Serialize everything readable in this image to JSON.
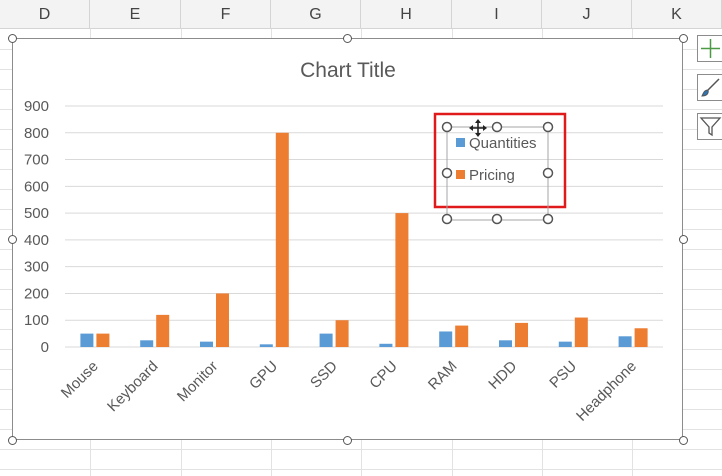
{
  "spreadsheet": {
    "columns": [
      "D",
      "E",
      "F",
      "G",
      "H",
      "I",
      "J",
      "K"
    ]
  },
  "chart_tools": {
    "add_element_icon": "plus-icon",
    "style_icon": "brush-icon",
    "filter_icon": "funnel-icon"
  },
  "chart_data": {
    "type": "bar",
    "title": "Chart Title",
    "categories": [
      "Mouse",
      "Keyboard",
      "Monitor",
      "GPU",
      "SSD",
      "CPU",
      "RAM",
      "HDD",
      "PSU",
      "Headphone"
    ],
    "series": [
      {
        "name": "Quantities",
        "color": "#5b9bd5",
        "values": [
          50,
          25,
          20,
          10,
          50,
          12,
          58,
          25,
          20,
          40
        ]
      },
      {
        "name": "Pricing",
        "color": "#ed7d31",
        "values": [
          50,
          120,
          200,
          800,
          100,
          500,
          80,
          90,
          110,
          70
        ]
      }
    ],
    "ylim": [
      0,
      900
    ],
    "yticks": [
      0,
      100,
      200,
      300,
      400,
      500,
      600,
      700,
      800,
      900
    ],
    "grid": true,
    "legend_position": "top-right",
    "legend_selected": true,
    "selection_highlight_color": "#e01a1a"
  }
}
